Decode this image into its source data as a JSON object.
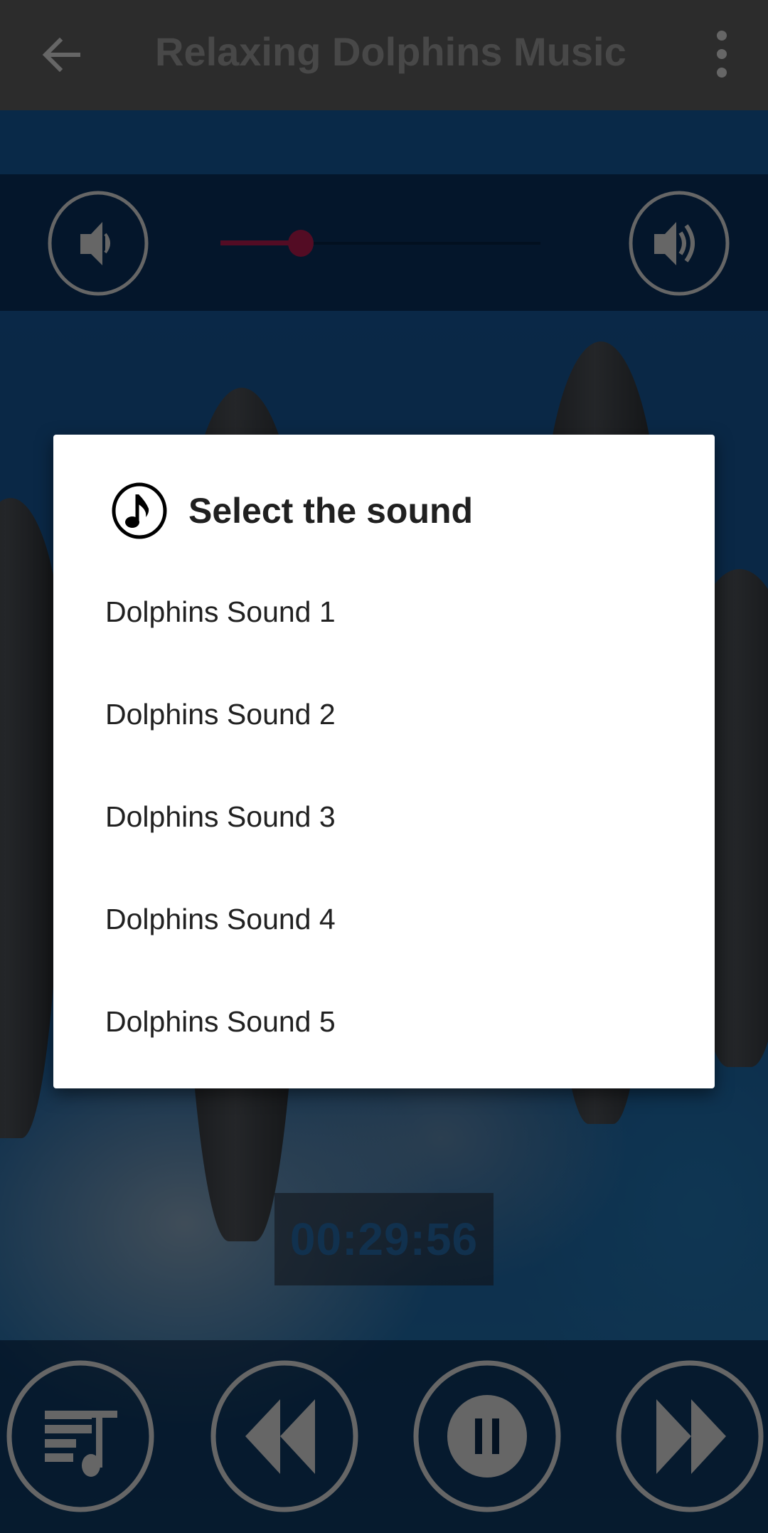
{
  "app_bar": {
    "title": "Relaxing Dolphins Music",
    "back_icon": "arrow-left-icon",
    "menu_icon": "more-vert-icon"
  },
  "volume": {
    "down_icon": "volume-down-icon",
    "up_icon": "volume-up-icon",
    "level_fraction": 0.25,
    "accent_color": "#d01f5a"
  },
  "timer": {
    "value": "00:29:56"
  },
  "controls": [
    {
      "name": "playlist",
      "icon": "playlist-music-icon"
    },
    {
      "name": "rewind",
      "icon": "rewind-icon"
    },
    {
      "name": "pause",
      "icon": "pause-icon"
    },
    {
      "name": "fast-forward",
      "icon": "fast-forward-icon"
    }
  ],
  "dialog": {
    "icon": "music-note-icon",
    "title": "Select the sound",
    "options": [
      {
        "label": "Dolphins Sound 1"
      },
      {
        "label": "Dolphins Sound 2"
      },
      {
        "label": "Dolphins Sound 3"
      },
      {
        "label": "Dolphins Sound 4"
      },
      {
        "label": "Dolphins Sound 5"
      }
    ]
  }
}
